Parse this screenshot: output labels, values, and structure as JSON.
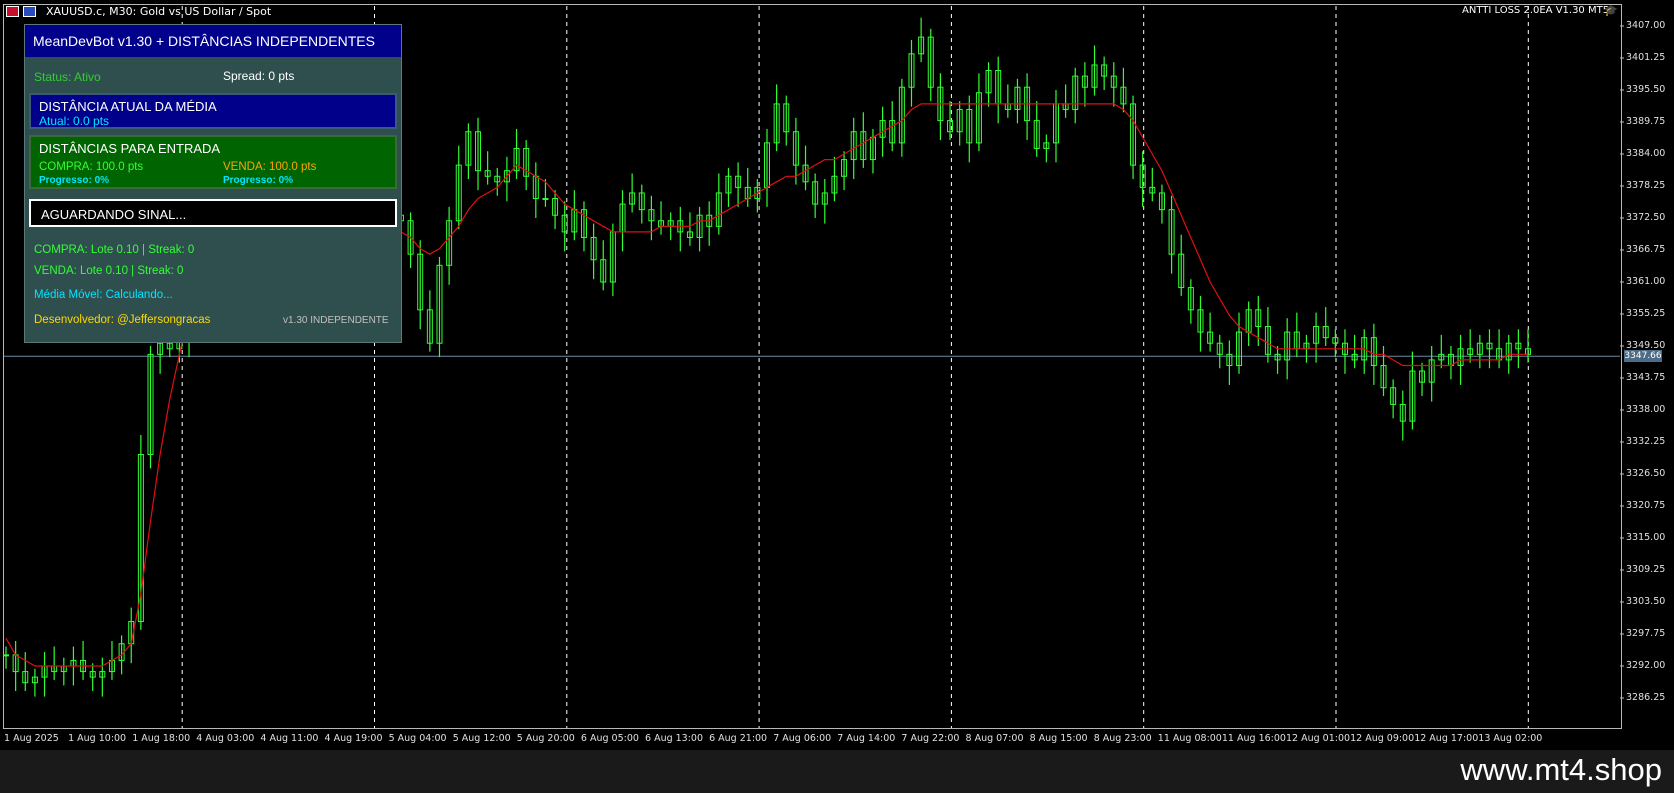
{
  "window": {
    "symbol_title": "XAUUSD.c, M30:  Gold vs US Dollar / Spot",
    "ea_badge": "ANTTI LOSS 2.0EA V1.30 MT5"
  },
  "colors": {
    "candles": "#32ff32",
    "moving_average": "#e01010",
    "grid": "#ffffff",
    "panel_bg": "#2f4f4f",
    "panel_header": "#00008b",
    "entry_box": "#006400",
    "status_green": "#32cd32",
    "sell_orange": "#ffa500",
    "cyan": "#00e5ff",
    "dev_yellow": "#ffd700"
  },
  "ea_panel": {
    "title": "MeanDevBot v1.30 + DISTÂNCIAS INDEPENDENTES",
    "status": "Status: Ativo",
    "spread": "Spread: 0 pts",
    "distance_title": "DISTÂNCIA ATUAL DA MÉDIA",
    "distance_current": "Atual: 0.0 pts",
    "entry_title": "DISTÂNCIAS PARA ENTRADA",
    "buy_distance": "COMPRA: 100.0 pts",
    "sell_distance": "VENDA: 100.0 pts",
    "buy_progress": "Progresso: 0%",
    "sell_progress": "Progresso: 0%",
    "signal": "AGUARDANDO SINAL...",
    "buy_lot": "COMPRA: Lote 0.10 | Streak: 0",
    "sell_lot": "VENDA: Lote 0.10 | Streak: 0",
    "moving_avg": "Média Móvel: Calculando...",
    "developer": "Desenvolvedor: @Jeffersongracas",
    "version": "v1.30 INDEPENDENTE"
  },
  "current_price": "3347.66",
  "watermark": "www.mt4.shop",
  "chart_data": {
    "type": "line",
    "title": "XAUUSD.c, M30",
    "ylim": [
      3281,
      3412
    ],
    "y_ticks": [
      "3407.00",
      "3401.25",
      "3395.50",
      "3389.75",
      "3384.00",
      "3378.25",
      "3372.50",
      "3366.75",
      "3361.00",
      "3355.25",
      "3349.50",
      "3343.75",
      "3338.00",
      "3332.25",
      "3326.50",
      "3320.75",
      "3315.00",
      "3309.25",
      "3303.50",
      "3297.75",
      "3292.00",
      "3286.25"
    ],
    "x_ticks": [
      "1 Aug 2025",
      "1 Aug 10:00",
      "1 Aug 18:00",
      "4 Aug 03:00",
      "4 Aug 11:00",
      "4 Aug 19:00",
      "5 Aug 04:00",
      "5 Aug 12:00",
      "5 Aug 20:00",
      "6 Aug 05:00",
      "6 Aug 13:00",
      "6 Aug 21:00",
      "7 Aug 06:00",
      "7 Aug 14:00",
      "7 Aug 22:00",
      "8 Aug 07:00",
      "8 Aug 15:00",
      "8 Aug 23:00",
      "11 Aug 08:00",
      "11 Aug 16:00",
      "12 Aug 01:00",
      "12 Aug 09:00",
      "12 Aug 17:00",
      "13 Aug 02:00"
    ],
    "vlines_at_tick_index": [
      2,
      5,
      8,
      11,
      14,
      17,
      20,
      23
    ],
    "series": [
      {
        "kind": "price",
        "values": [
          3294,
          3291,
          3289,
          3290,
          3292,
          3291,
          3292,
          3293,
          3291,
          3290,
          3291,
          3293,
          3296,
          3300,
          3330,
          3348,
          3350,
          3349,
          3351,
          3352,
          3353,
          3355,
          3362,
          3368,
          3366,
          3364,
          3366,
          3368,
          3365,
          3362,
          3374,
          3376,
          3375,
          3373,
          3372,
          3370,
          3369,
          3371,
          3372,
          3374,
          3373,
          3372,
          3366,
          3356,
          3350,
          3364,
          3372,
          3382,
          3388,
          3381,
          3380,
          3379,
          3381,
          3385,
          3380,
          3376,
          3376,
          3373,
          3370,
          3374,
          3369,
          3365,
          3361,
          3370,
          3375,
          3377,
          3374,
          3372,
          3371,
          3372,
          3370,
          3369,
          3373,
          3371,
          3377,
          3380,
          3378,
          3376,
          3378,
          3386,
          3393,
          3388,
          3382,
          3379,
          3375,
          3377,
          3380,
          3383,
          3388,
          3383,
          3387,
          3390,
          3386,
          3396,
          3402,
          3405,
          3396,
          3390,
          3388,
          3392,
          3386,
          3395,
          3399,
          3393,
          3392,
          3396,
          3390,
          3385,
          3386,
          3393,
          3392,
          3398,
          3396,
          3400,
          3398,
          3396,
          3393,
          3382,
          3378,
          3377,
          3374,
          3366,
          3360,
          3356,
          3352,
          3350,
          3348,
          3346,
          3352,
          3356,
          3353,
          3348,
          3347,
          3352,
          3349,
          3350,
          3353,
          3351,
          3350,
          3348,
          3347,
          3351,
          3346,
          3342,
          3339,
          3336,
          3345,
          3343,
          3347,
          3348,
          3346,
          3349,
          3348,
          3350,
          3349,
          3347,
          3350,
          3349,
          3348
        ]
      },
      {
        "kind": "moving_average",
        "values": [
          3297,
          3294,
          3293,
          3292,
          3292,
          3292,
          3292,
          3292,
          3292,
          3292,
          3292,
          3293,
          3294,
          3296,
          3305,
          3318,
          3330,
          3340,
          3348,
          3356,
          3362,
          3366,
          3368,
          3370,
          3370,
          3371,
          3372,
          3373,
          3373,
          3374,
          3375,
          3375,
          3375,
          3374,
          3373,
          3372,
          3371,
          3371,
          3371,
          3371,
          3371,
          3370,
          3369,
          3367,
          3366,
          3367,
          3369,
          3371,
          3374,
          3376,
          3377,
          3378,
          3380,
          3382,
          3381,
          3380,
          3379,
          3377,
          3375,
          3374,
          3373,
          3372,
          3371,
          3370,
          3370,
          3370,
          3370,
          3370,
          3371,
          3371,
          3371,
          3371,
          3372,
          3372,
          3373,
          3374,
          3375,
          3376,
          3377,
          3378,
          3379,
          3380,
          3380,
          3381,
          3382,
          3383,
          3383,
          3384,
          3385,
          3386,
          3387,
          3388,
          3389,
          3390,
          3392,
          3393,
          3393,
          3393,
          3393,
          3393,
          3393,
          3393,
          3393,
          3393,
          3393,
          3393,
          3393,
          3393,
          3393,
          3393,
          3393,
          3393,
          3393,
          3393,
          3393,
          3393,
          3392,
          3390,
          3387,
          3384,
          3381,
          3377,
          3373,
          3369,
          3365,
          3361,
          3358,
          3355,
          3353,
          3352,
          3351,
          3350,
          3349,
          3349,
          3349,
          3349,
          3349,
          3349,
          3349,
          3349,
          3349,
          3349,
          3348,
          3348,
          3347,
          3346,
          3346,
          3346,
          3346,
          3346,
          3346,
          3347,
          3347,
          3347,
          3347,
          3347,
          3348,
          3348,
          3348
        ]
      }
    ]
  }
}
